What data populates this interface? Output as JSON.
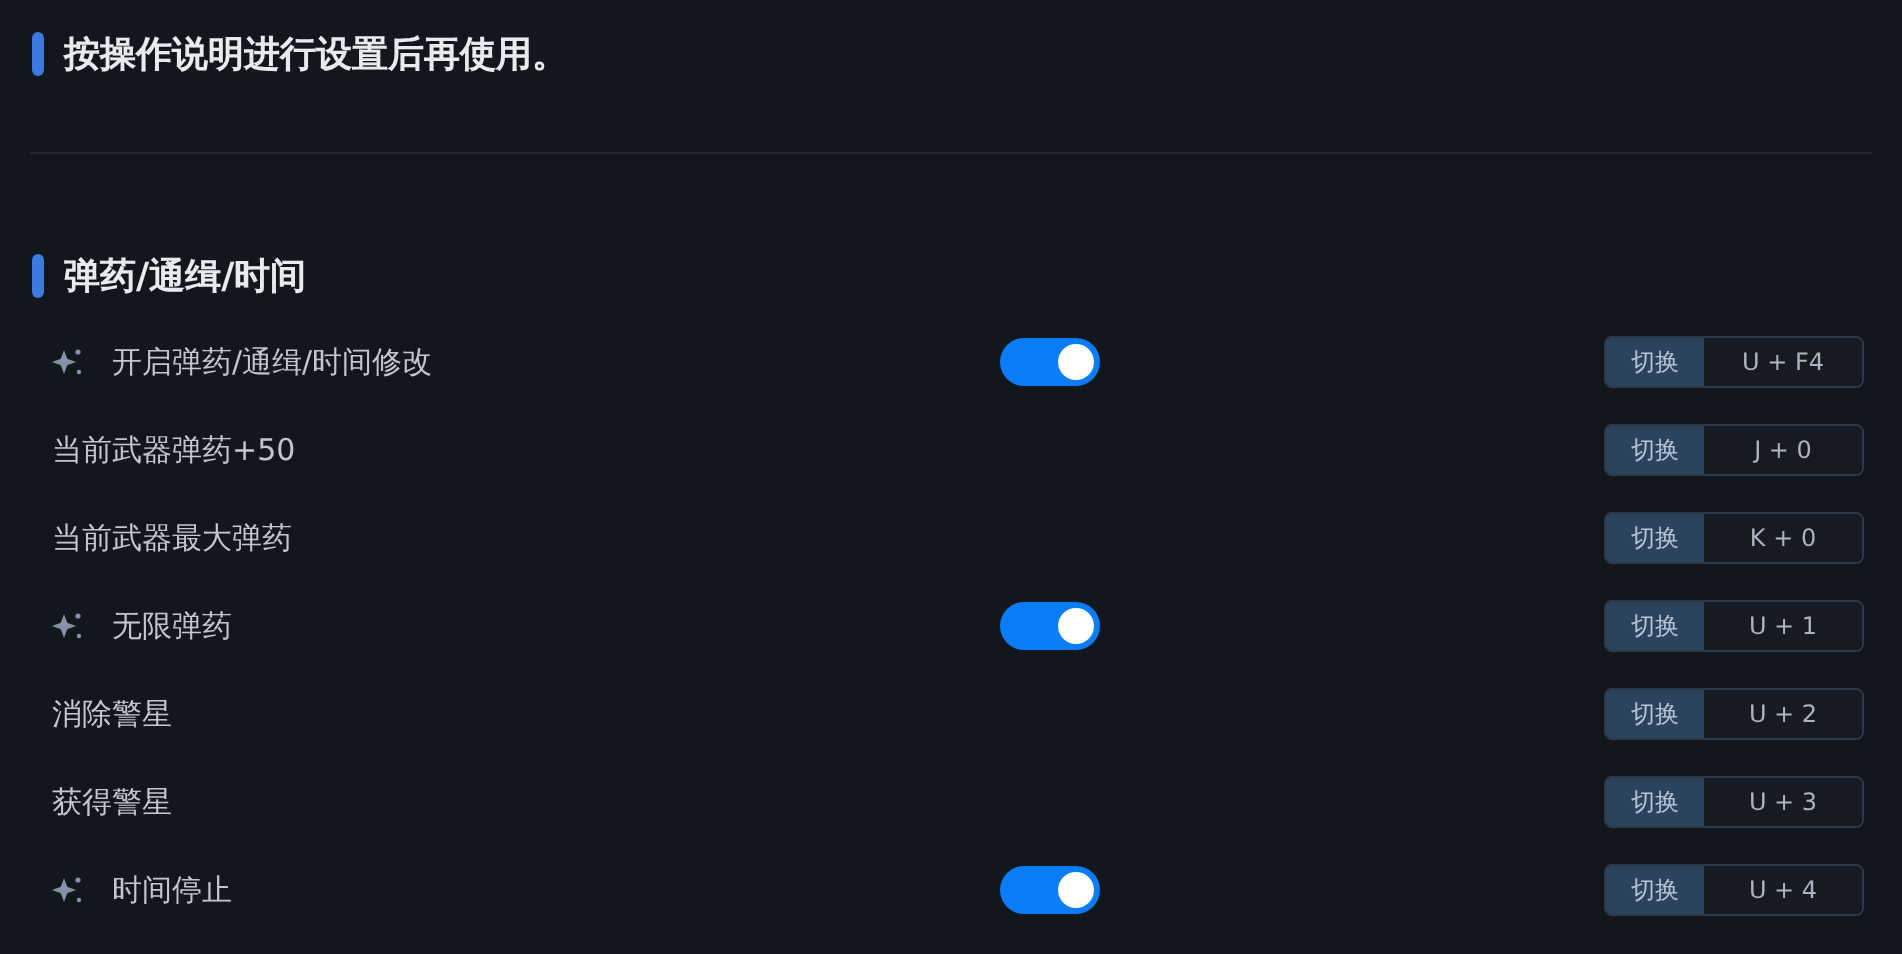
{
  "notice": {
    "title": "按操作说明进行设置后再使用。"
  },
  "section": {
    "title": "弹药/通缉/时间",
    "rows": [
      {
        "kind": "toggle",
        "label": "开启弹药/通缉/时间修改",
        "on": true,
        "key_label": "切换",
        "hotkey": "U + F4"
      },
      {
        "kind": "action",
        "label": "当前武器弹药+50",
        "key_label": "切换",
        "hotkey": "J + 0"
      },
      {
        "kind": "action",
        "label": "当前武器最大弹药",
        "key_label": "切换",
        "hotkey": "K + 0"
      },
      {
        "kind": "toggle",
        "label": "无限弹药",
        "on": true,
        "key_label": "切换",
        "hotkey": "U + 1"
      },
      {
        "kind": "action",
        "label": "消除警星",
        "key_label": "切换",
        "hotkey": "U + 2"
      },
      {
        "kind": "action",
        "label": "获得警星",
        "key_label": "切换",
        "hotkey": "U + 3"
      },
      {
        "kind": "toggle",
        "label": "时间停止",
        "on": true,
        "key_label": "切换",
        "hotkey": "U + 4"
      }
    ]
  }
}
